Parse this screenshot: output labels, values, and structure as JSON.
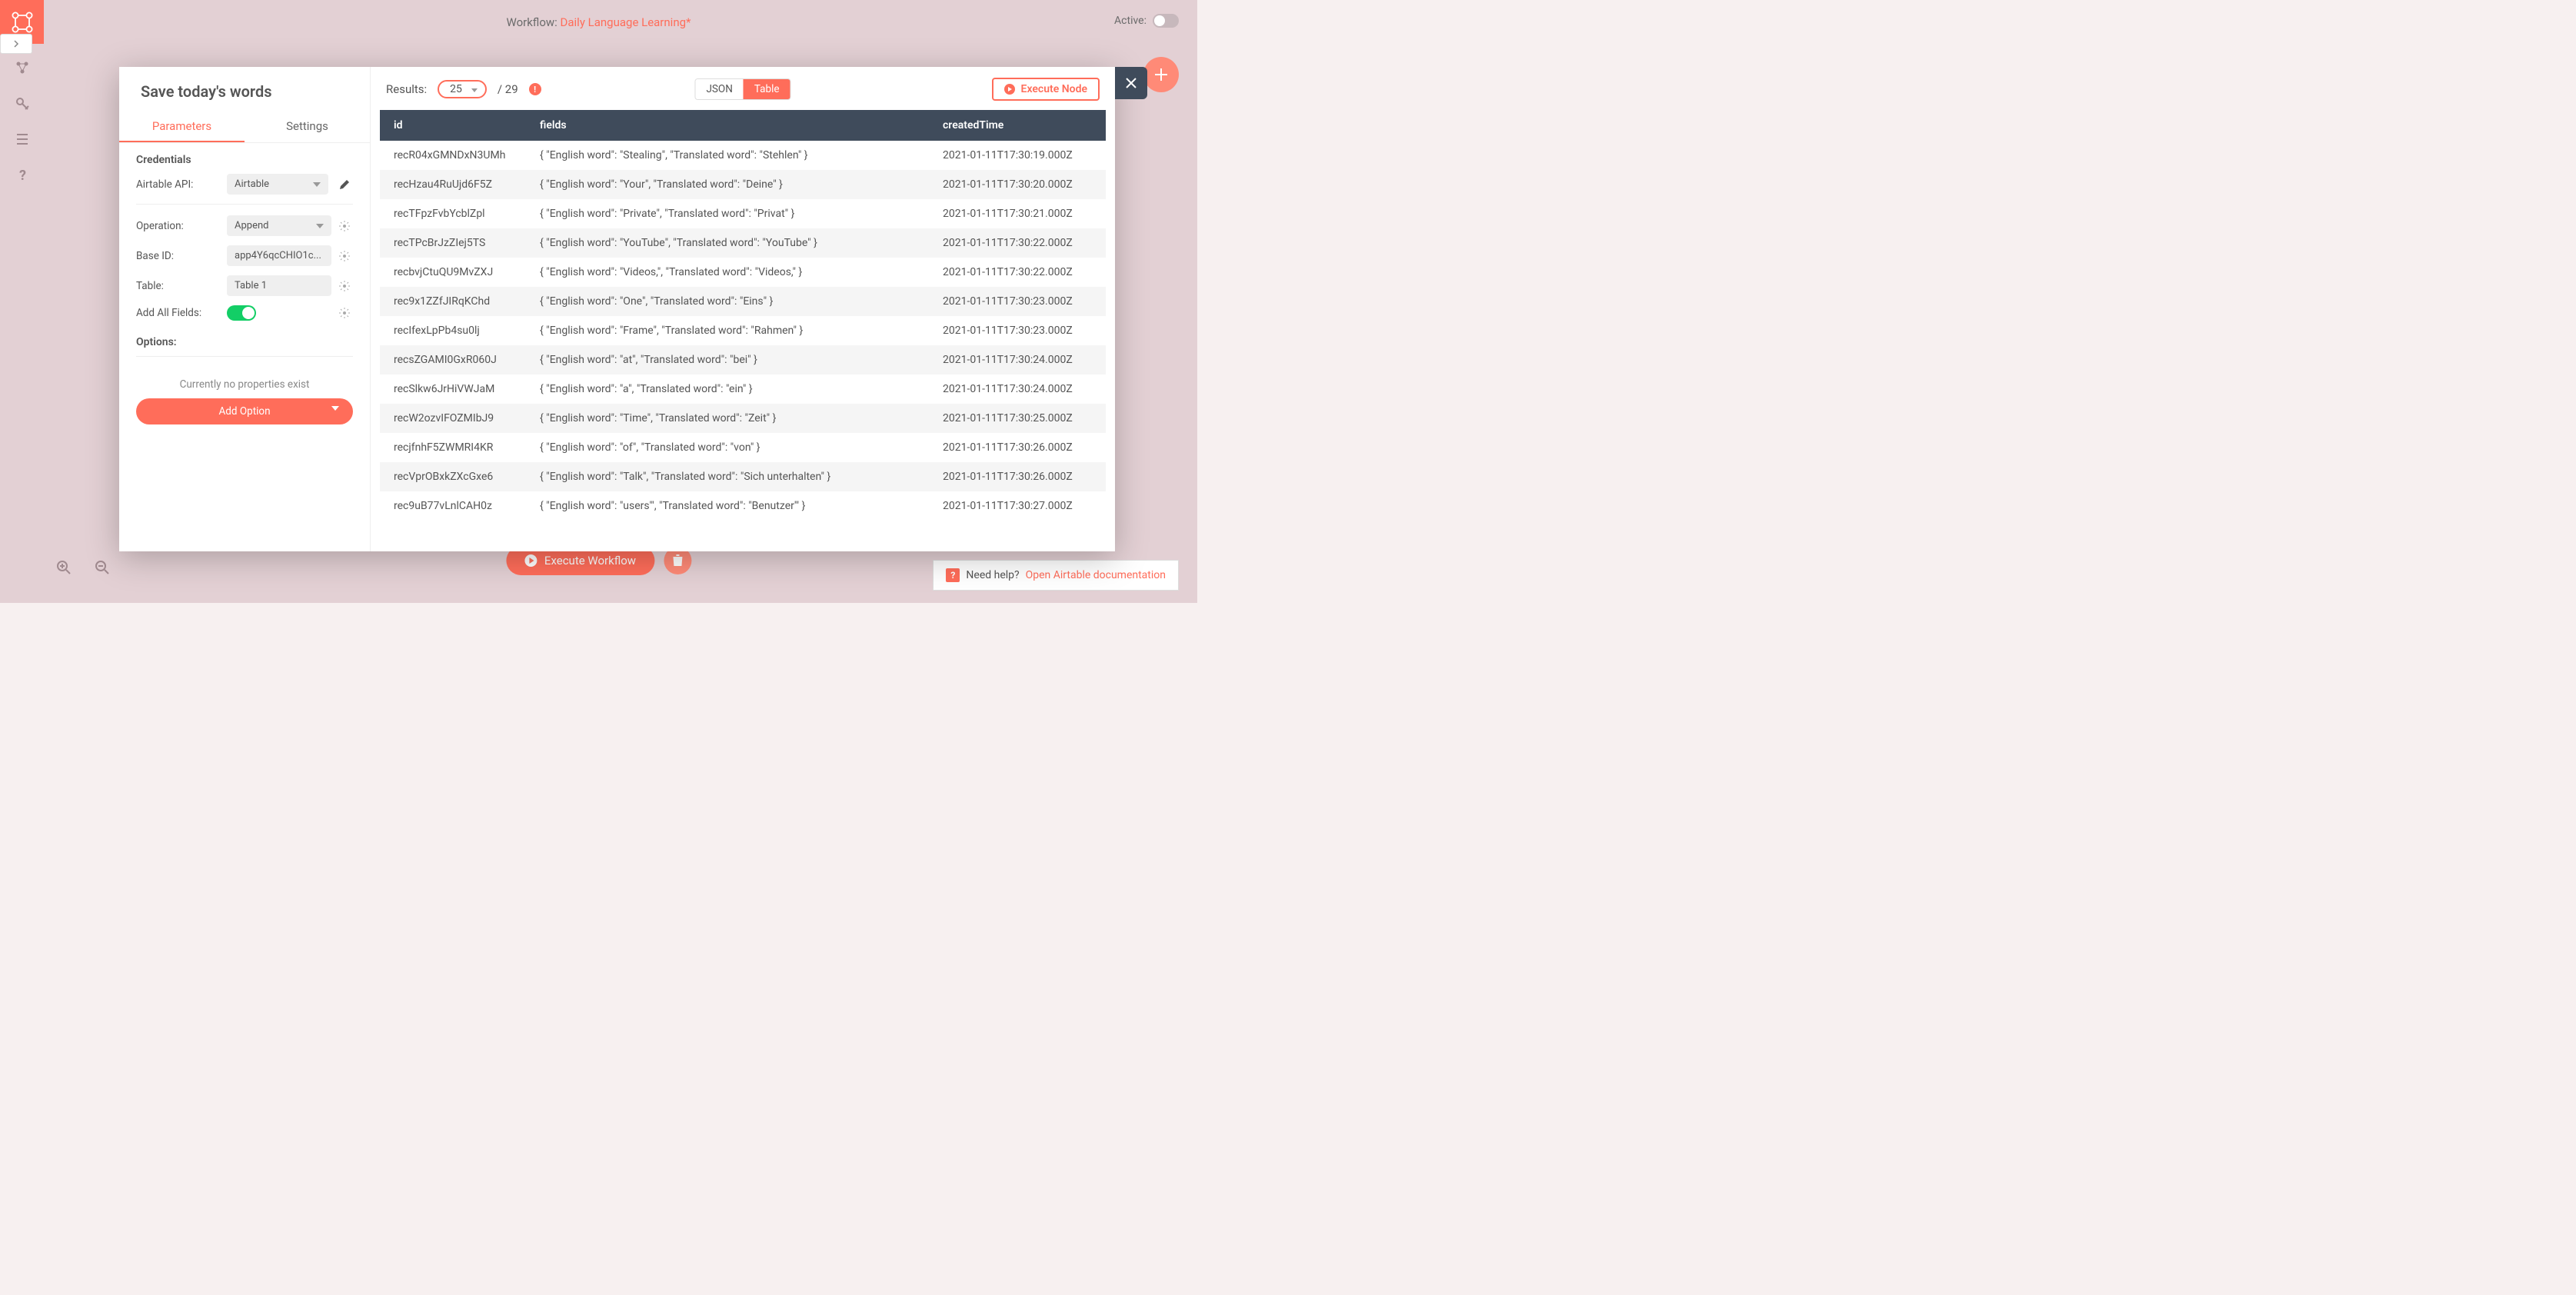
{
  "header": {
    "workflow_prefix": "Workflow:",
    "workflow_name": "Daily Language Learning*",
    "active_label": "Active:"
  },
  "modal": {
    "title": "Save today's words",
    "tabs": {
      "parameters": "Parameters",
      "settings": "Settings"
    },
    "credentials_heading": "Credentials",
    "fields": {
      "airtable_api_label": "Airtable API:",
      "airtable_api_value": "Airtable",
      "operation_label": "Operation:",
      "operation_value": "Append",
      "base_id_label": "Base ID:",
      "base_id_value": "app4Y6qcCHIO1c...",
      "table_label": "Table:",
      "table_value": "Table 1",
      "add_all_label": "Add All Fields:"
    },
    "options_heading": "Options:",
    "no_properties": "Currently no properties exist",
    "add_option": "Add Option",
    "results_label": "Results:",
    "results_count": "25",
    "results_total": "/ 29",
    "view_json": "JSON",
    "view_table": "Table",
    "execute_node": "Execute Node"
  },
  "table": {
    "headers": {
      "id": "id",
      "fields": "fields",
      "created": "createdTime"
    },
    "rows": [
      {
        "id": "recR04xGMNDxN3UMh",
        "fields": "{ \"English word\": \"Stealing\", \"Translated word\": \"Stehlen\" }",
        "created": "2021-01-11T17:30:19.000Z"
      },
      {
        "id": "recHzau4RuUjd6F5Z",
        "fields": "{ \"English word\": \"Your\", \"Translated word\": \"Deine\" }",
        "created": "2021-01-11T17:30:20.000Z"
      },
      {
        "id": "recTFpzFvbYcblZpl",
        "fields": "{ \"English word\": \"Private\", \"Translated word\": \"Privat\" }",
        "created": "2021-01-11T17:30:21.000Z"
      },
      {
        "id": "recTPcBrJzZIej5TS",
        "fields": "{ \"English word\": \"YouTube\", \"Translated word\": \"YouTube\" }",
        "created": "2021-01-11T17:30:22.000Z"
      },
      {
        "id": "recbvjCtuQU9MvZXJ",
        "fields": "{ \"English word\": \"Videos,\", \"Translated word\": \"Videos,\" }",
        "created": "2021-01-11T17:30:22.000Z"
      },
      {
        "id": "rec9x1ZZfJIRqKChd",
        "fields": "{ \"English word\": \"One\", \"Translated word\": \"Eins\" }",
        "created": "2021-01-11T17:30:23.000Z"
      },
      {
        "id": "recIfexLpPb4su0lj",
        "fields": "{ \"English word\": \"Frame\", \"Translated word\": \"Rahmen\" }",
        "created": "2021-01-11T17:30:23.000Z"
      },
      {
        "id": "recsZGAMI0GxR060J",
        "fields": "{ \"English word\": \"at\", \"Translated word\": \"bei\" }",
        "created": "2021-01-11T17:30:24.000Z"
      },
      {
        "id": "recSlkw6JrHiVWJaM",
        "fields": "{ \"English word\": \"a\", \"Translated word\": \"ein\" }",
        "created": "2021-01-11T17:30:24.000Z"
      },
      {
        "id": "recW2ozvIFOZMIbJ9",
        "fields": "{ \"English word\": \"Time\", \"Translated word\": \"Zeit\" }",
        "created": "2021-01-11T17:30:25.000Z"
      },
      {
        "id": "recjfnhF5ZWMRI4KR",
        "fields": "{ \"English word\": \"of\", \"Translated word\": \"von\" }",
        "created": "2021-01-11T17:30:26.000Z"
      },
      {
        "id": "recVprOBxkZXcGxe6",
        "fields": "{ \"English word\": \"Talk\", \"Translated word\": \"Sich unterhalten\" }",
        "created": "2021-01-11T17:30:26.000Z"
      },
      {
        "id": "rec9uB77vLnlCAH0z",
        "fields": "{ \"English word\": \"users'\", \"Translated word\": \"Benutzer'\" }",
        "created": "2021-01-11T17:30:27.000Z"
      }
    ]
  },
  "footer": {
    "execute_workflow": "Execute Workflow",
    "help_text": "Need help?",
    "help_link": "Open Airtable documentation"
  }
}
